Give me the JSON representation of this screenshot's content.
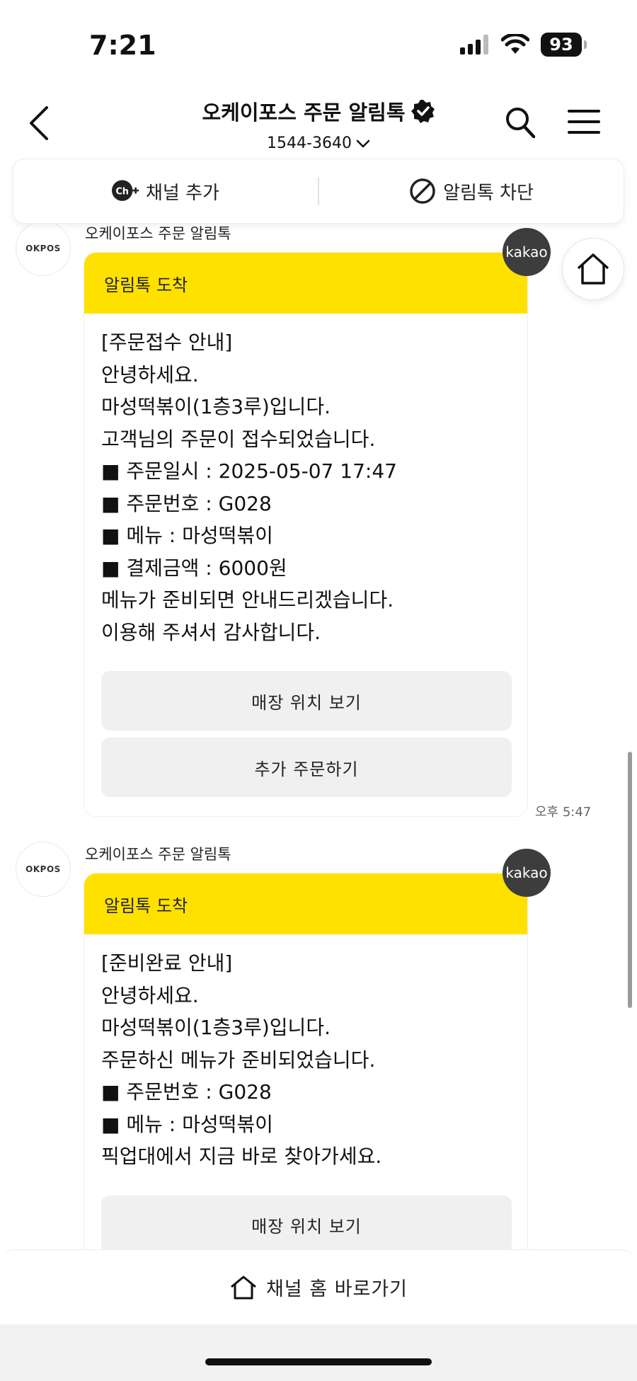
{
  "status_bar": {
    "time": "7:21",
    "battery": "93"
  },
  "header": {
    "title": "오케이포스 주문 알림톡",
    "phone": "1544-3640"
  },
  "actions": {
    "add_channel": "채널 추가",
    "block": "알림톡 차단"
  },
  "messages": [
    {
      "sender": "오케이포스 주문 알림톡",
      "avatar_text": "OKPOS",
      "badge": "kakao",
      "header": "알림톡 도착",
      "lines": [
        "[주문접수 안내]",
        "안녕하세요.",
        "마성떡볶이(1층3루)입니다.",
        "고객님의 주문이 접수되었습니다.",
        "■ 주문일시 : 2025-05-07 17:47",
        "■ 주문번호 : G028",
        "■ 메뉴 : 마성떡볶이",
        "■ 결제금액 : 6000원",
        "메뉴가 준비되면 안내드리겠습니다.",
        "이용해 주셔서 감사합니다."
      ],
      "buttons": [
        "매장 위치 보기",
        "추가 주문하기"
      ],
      "time": "오후 5:47"
    },
    {
      "sender": "오케이포스 주문 알림톡",
      "avatar_text": "OKPOS",
      "badge": "kakao",
      "header": "알림톡 도착",
      "lines": [
        "[준비완료 안내]",
        "안녕하세요.",
        "마성떡볶이(1층3루)입니다.",
        "주문하신 메뉴가 준비되었습니다.",
        "■ 주문번호 : G028",
        "■ 메뉴 : 마성떡볶이",
        "픽업대에서 지금 바로 찾아가세요."
      ],
      "buttons": [
        "매장 위치 보기"
      ]
    }
  ],
  "bottom": {
    "channel_home": "채널 홈 바로가기"
  },
  "colors": {
    "accent_yellow": "#ffe100",
    "badge_dark": "#3d3d3d"
  },
  "icons": [
    "back-icon",
    "verified-icon",
    "chevron-down-icon",
    "search-icon",
    "menu-icon",
    "channel-add-icon",
    "block-icon",
    "home-icon"
  ]
}
